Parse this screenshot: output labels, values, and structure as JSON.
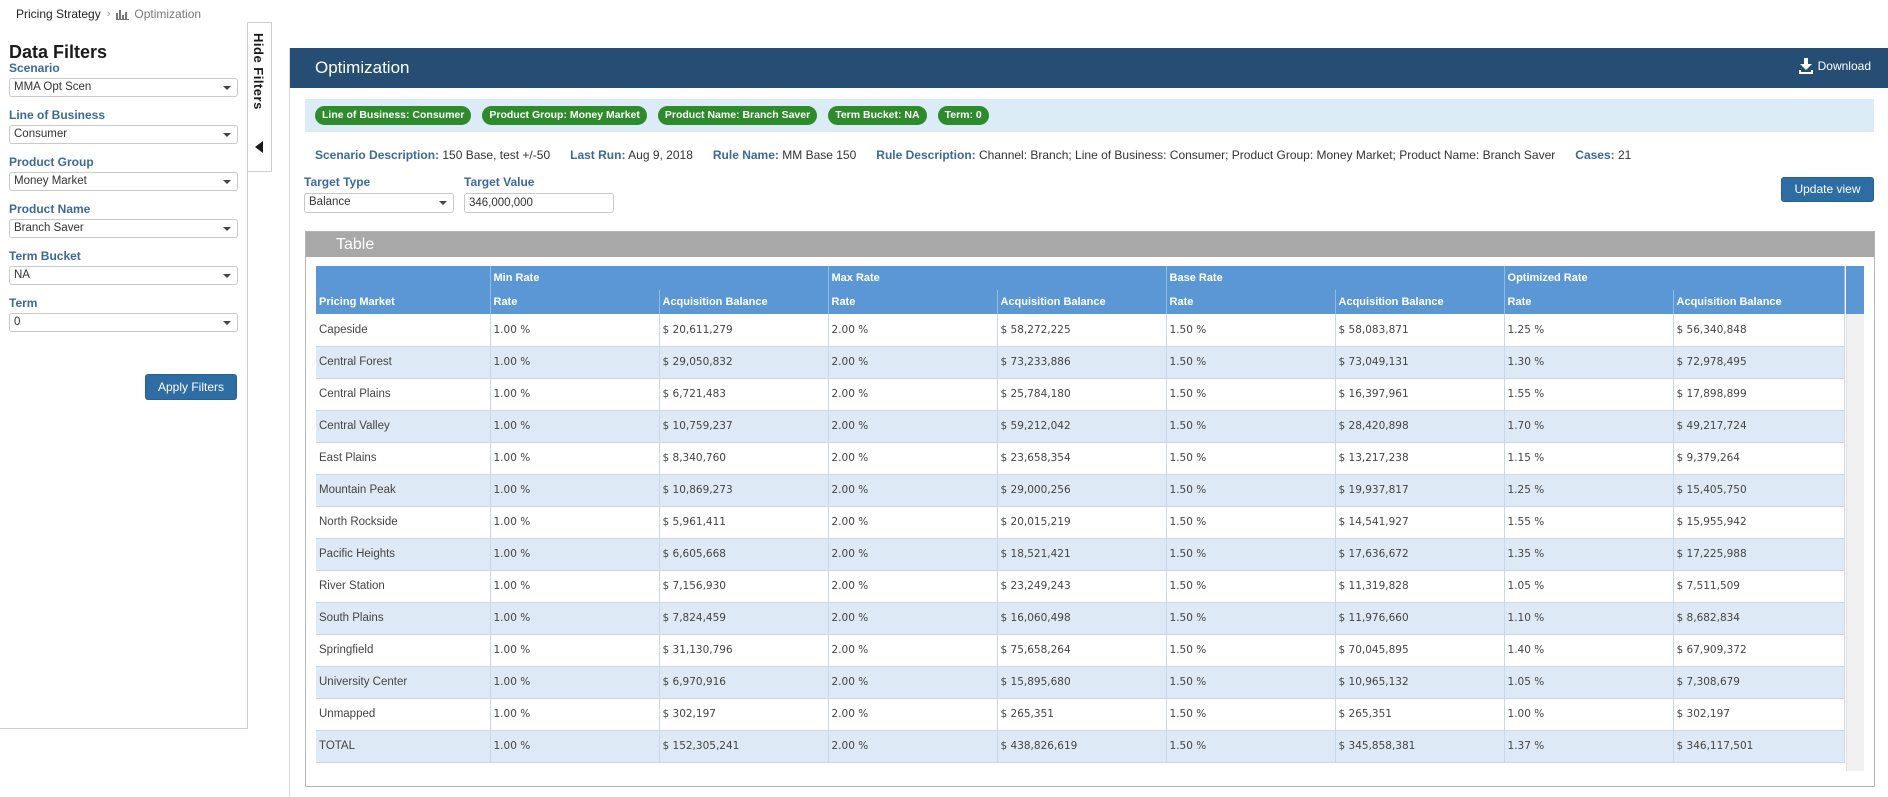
{
  "breadcrumb": {
    "root": "Pricing Strategy",
    "separator": "›",
    "current": "Optimization"
  },
  "filters": {
    "title": "Data Filters",
    "groups": [
      {
        "label": "Scenario",
        "value": "MMA Opt Scen"
      },
      {
        "label": "Line of Business",
        "value": "Consumer"
      },
      {
        "label": "Product Group",
        "value": "Money Market"
      },
      {
        "label": "Product Name",
        "value": "Branch Saver"
      },
      {
        "label": "Term Bucket",
        "value": "NA"
      },
      {
        "label": "Term",
        "value": "0"
      }
    ],
    "apply_label": "Apply Filters",
    "hide_label": "Hide Filters"
  },
  "main": {
    "title": "Optimization",
    "download_label": "Download",
    "chips": [
      "Line of Business: Consumer",
      "Product Group: Money Market",
      "Product Name: Branch Saver",
      "Term Bucket: NA",
      "Term: 0"
    ],
    "description": [
      {
        "label": "Scenario Description:",
        "value": "150 Base, test +/-50"
      },
      {
        "label": "Last Run:",
        "value": "Aug 9, 2018"
      },
      {
        "label": "Rule Name:",
        "value": "MM Base 150"
      },
      {
        "label": "Rule Description:",
        "value": "Channel: Branch; Line of Business: Consumer; Product Group: Money Market; Product Name: Branch Saver"
      },
      {
        "label": "Cases:",
        "value": "21"
      }
    ],
    "target_type": {
      "label": "Target Type",
      "value": "Balance"
    },
    "target_value": {
      "label": "Target Value",
      "value": "346,000,000"
    },
    "update_label": "Update view"
  },
  "table": {
    "title": "Table",
    "group_headers": [
      "Min Rate",
      "Max Rate",
      "Base Rate",
      "Optimized Rate"
    ],
    "sub_headers": [
      "Pricing Market",
      "Rate",
      "Acquisition Balance",
      "Rate",
      "Acquisition Balance",
      "Rate",
      "Acquisition Balance",
      "Rate",
      "Acquisition Balance"
    ],
    "rows": [
      [
        "Capeside",
        "1.00 %",
        "$ 20,611,279",
        "2.00 %",
        "$ 58,272,225",
        "1.50 %",
        "$ 58,083,871",
        "1.25 %",
        "$ 56,340,848"
      ],
      [
        "Central Forest",
        "1.00 %",
        "$ 29,050,832",
        "2.00 %",
        "$ 73,233,886",
        "1.50 %",
        "$ 73,049,131",
        "1.30 %",
        "$ 72,978,495"
      ],
      [
        "Central Plains",
        "1.00 %",
        "$ 6,721,483",
        "2.00 %",
        "$ 25,784,180",
        "1.50 %",
        "$ 16,397,961",
        "1.55 %",
        "$ 17,898,899"
      ],
      [
        "Central Valley",
        "1.00 %",
        "$ 10,759,237",
        "2.00 %",
        "$ 59,212,042",
        "1.50 %",
        "$ 28,420,898",
        "1.70 %",
        "$ 49,217,724"
      ],
      [
        "East Plains",
        "1.00 %",
        "$ 8,340,760",
        "2.00 %",
        "$ 23,658,354",
        "1.50 %",
        "$ 13,217,238",
        "1.15 %",
        "$ 9,379,264"
      ],
      [
        "Mountain Peak",
        "1.00 %",
        "$ 10,869,273",
        "2.00 %",
        "$ 29,000,256",
        "1.50 %",
        "$ 19,937,817",
        "1.25 %",
        "$ 15,405,750"
      ],
      [
        "North Rockside",
        "1.00 %",
        "$ 5,961,411",
        "2.00 %",
        "$ 20,015,219",
        "1.50 %",
        "$ 14,541,927",
        "1.55 %",
        "$ 15,955,942"
      ],
      [
        "Pacific Heights",
        "1.00 %",
        "$ 6,605,668",
        "2.00 %",
        "$ 18,521,421",
        "1.50 %",
        "$ 17,636,672",
        "1.35 %",
        "$ 17,225,988"
      ],
      [
        "River Station",
        "1.00 %",
        "$ 7,156,930",
        "2.00 %",
        "$ 23,249,243",
        "1.50 %",
        "$ 11,319,828",
        "1.05 %",
        "$ 7,511,509"
      ],
      [
        "South Plains",
        "1.00 %",
        "$ 7,824,459",
        "2.00 %",
        "$ 16,060,498",
        "1.50 %",
        "$ 11,976,660",
        "1.10 %",
        "$ 8,682,834"
      ],
      [
        "Springfield",
        "1.00 %",
        "$ 31,130,796",
        "2.00 %",
        "$ 75,658,264",
        "1.50 %",
        "$ 70,045,895",
        "1.40 %",
        "$ 67,909,372"
      ],
      [
        "University Center",
        "1.00 %",
        "$ 6,970,916",
        "2.00 %",
        "$ 15,895,680",
        "1.50 %",
        "$ 10,965,132",
        "1.05 %",
        "$ 7,308,679"
      ],
      [
        "Unmapped",
        "1.00 %",
        "$ 302,197",
        "2.00 %",
        "$ 265,351",
        "1.50 %",
        "$ 265,351",
        "1.00 %",
        "$ 302,197"
      ],
      [
        "TOTAL",
        "1.00 %",
        "$ 152,305,241",
        "2.00 %",
        "$ 438,826,619",
        "1.50 %",
        "$ 345,858,381",
        "1.37 %",
        "$ 346,117,501"
      ]
    ]
  },
  "colors": {
    "header_bar": "#264e75",
    "chip_green": "#2e8b2b",
    "table_header": "#5b97d4",
    "row_alt": "#dde9f5",
    "label_blue": "#3b6a99",
    "button_blue": "#2e6da4"
  },
  "icons": [
    "chart-icon",
    "chevron-left-icon",
    "download-icon",
    "caret-down-icon"
  ]
}
